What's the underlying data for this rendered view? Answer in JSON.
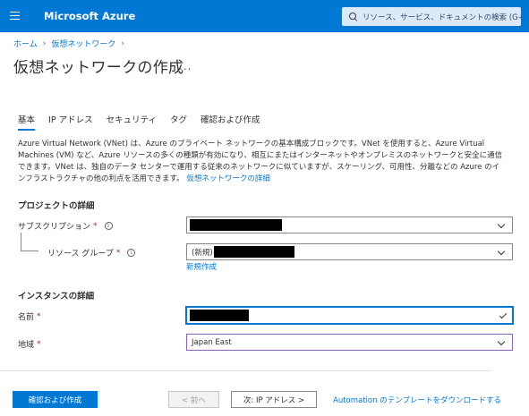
{
  "header": {
    "brand": "Microsoft Azure",
    "search_placeholder": "リソース、サービス、ドキュメントの検索 (G+/)"
  },
  "breadcrumb": {
    "items": [
      "ホーム",
      "仮想ネットワーク"
    ]
  },
  "page": {
    "title": "仮想ネットワークの作成",
    "more": "..."
  },
  "tabs": [
    {
      "label": "基本",
      "active": true
    },
    {
      "label": "IP アドレス",
      "active": false
    },
    {
      "label": "セキュリティ",
      "active": false
    },
    {
      "label": "タグ",
      "active": false
    },
    {
      "label": "確認および作成",
      "active": false
    }
  ],
  "description": {
    "text": "Azure Virtual Network (VNet) は、Azure のプライベート ネットワークの基本構成ブロックです。VNet を使用すると、Azure Virtual Machines (VM) など、Azure リソースの多くの種類が有効になり、相互にまたはインターネットやオンプレミスのネットワークと安全に通信できます。VNet は、独自のデータ センターで運用する従来のネットワークに似ていますが、スケーリング、可用性、分離などの Azure のインフラストラクチャの他の利点を活用できます。",
    "link": "仮想ネットワークの詳細"
  },
  "project": {
    "heading": "プロジェクトの詳細",
    "subscription_label": "サブスクリプション",
    "resource_group_label": "リソース グループ",
    "resource_group_value": "(新規)",
    "create_new": "新規作成"
  },
  "instance": {
    "heading": "インスタンスの詳細",
    "name_label": "名前",
    "region_label": "地域",
    "region_value": "Japan East"
  },
  "required_mark": "*",
  "info_glyph": "i",
  "footer": {
    "review_create": "確認および作成",
    "prev": "< 前へ",
    "next": "次: IP アドレス >",
    "download": "Automation のテンプレートをダウンロードする"
  },
  "colors": {
    "topbar": "#0078d4",
    "link": "#0078d4",
    "required": "#a4262c",
    "region_border": "#8764b8"
  }
}
